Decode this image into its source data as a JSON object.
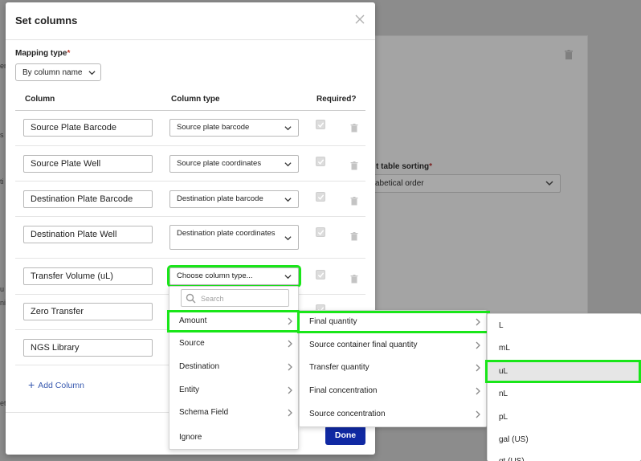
{
  "background": {
    "label": "t table sorting",
    "select_value": "abetical order",
    "left_fragments": [
      "er",
      "s",
      "ti",
      "u",
      "ni",
      "et"
    ]
  },
  "modal": {
    "title": "Set columns",
    "mapping_type_label": "Mapping type",
    "mapping_type_value": "By column name",
    "headers": {
      "column": "Column",
      "column_type": "Column type",
      "required": "Required?"
    },
    "rows": [
      {
        "column": "Source Plate Barcode",
        "type": "Source plate barcode"
      },
      {
        "column": "Source Plate Well",
        "type": "Source plate coordinates"
      },
      {
        "column": "Destination Plate Barcode",
        "type": "Destination plate barcode"
      },
      {
        "column": "Destination Plate Well",
        "type": "Destination plate coordinates"
      },
      {
        "column": "Transfer Volume (uL)",
        "type": "Choose column type..."
      },
      {
        "column": "Zero Transfer",
        "type": ""
      },
      {
        "column": "NGS Library",
        "type": ""
      }
    ],
    "add_column": "Add Column",
    "done": "Done"
  },
  "menu1": {
    "search_placeholder": "Search",
    "items": [
      "Amount",
      "Source",
      "Destination",
      "Entity",
      "Schema Field",
      "Ignore"
    ]
  },
  "menu2": {
    "items": [
      "Final quantity",
      "Source container final quantity",
      "Transfer quantity",
      "Final concentration",
      "Source concentration"
    ]
  },
  "menu3": {
    "items": [
      "L",
      "mL",
      "uL",
      "nL",
      "pL",
      "gal (US)",
      "qt (US)"
    ]
  },
  "colors": {
    "highlight": "#19e619",
    "primary": "#1029a3",
    "link": "#3a5bb0"
  }
}
